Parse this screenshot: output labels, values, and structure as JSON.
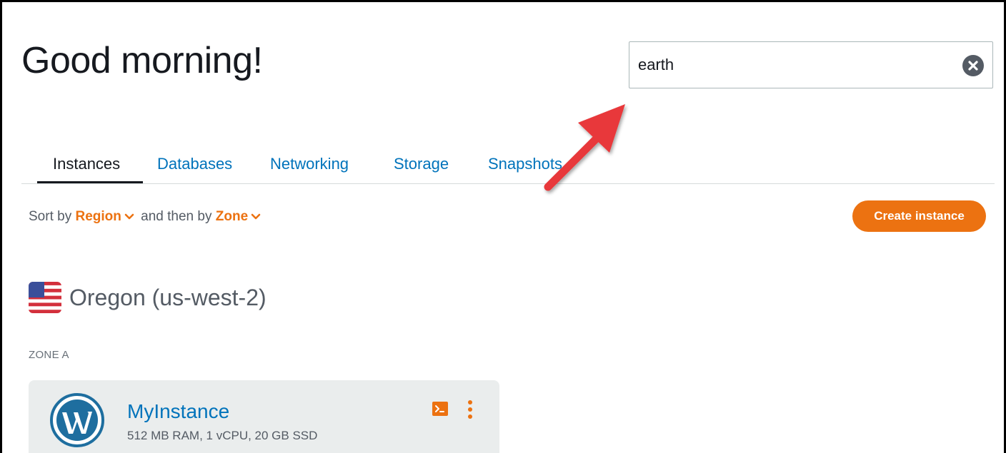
{
  "header": {
    "greeting": "Good morning!"
  },
  "search": {
    "value": "earth",
    "clear_icon": "clear-x-circle-icon"
  },
  "tabs": [
    {
      "label": "Instances",
      "active": true
    },
    {
      "label": "Databases",
      "active": false
    },
    {
      "label": "Networking",
      "active": false
    },
    {
      "label": "Storage",
      "active": false
    },
    {
      "label": "Snapshots",
      "active": false
    }
  ],
  "sort": {
    "prefix": "Sort by",
    "primary": "Region",
    "middle": "and then by",
    "secondary": "Zone"
  },
  "actions": {
    "create_instance": "Create instance"
  },
  "region": {
    "name": "Oregon (us-west-2)",
    "flag_icon": "us-flag-icon"
  },
  "zone": {
    "label": "ZONE A"
  },
  "instance": {
    "name": "MyInstance",
    "specs": "512 MB RAM, 1 vCPU, 20 GB SSD",
    "logo_icon": "wordpress-logo-icon",
    "connect_icon": "terminal-icon",
    "menu_icon": "more-vertical-icon"
  },
  "colors": {
    "accent": "#ec7211",
    "link": "#0073bb",
    "text": "#16191f",
    "annotation_arrow": "#e8383a"
  }
}
